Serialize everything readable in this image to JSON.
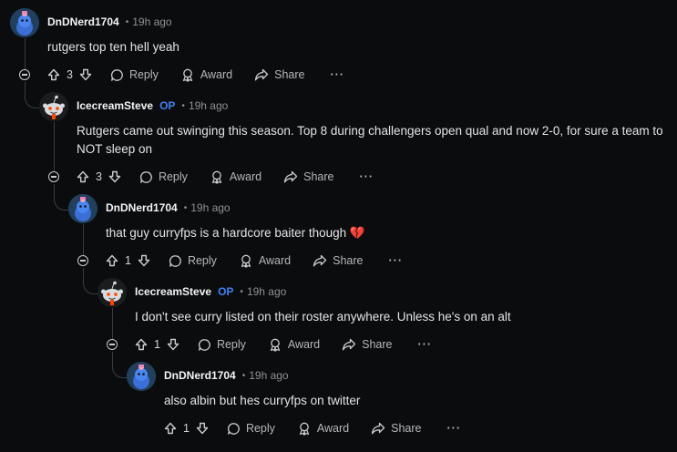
{
  "comments": [
    {
      "author": "DnDNerd1704",
      "is_op": false,
      "time": "19h ago",
      "text": "rutgers top ten hell yeah",
      "votes": "3",
      "reply_label": "Reply",
      "award_label": "Award",
      "share_label": "Share",
      "more_label": "···"
    },
    {
      "author": "IcecreamSteve",
      "is_op": true,
      "op_label": "OP",
      "time": "19h ago",
      "text": "Rutgers came out swinging this season. Top 8 during challengers open qual and now 2-0, for sure a team to NOT sleep on",
      "votes": "3",
      "reply_label": "Reply",
      "award_label": "Award",
      "share_label": "Share",
      "more_label": "···"
    },
    {
      "author": "DnDNerd1704",
      "is_op": false,
      "time": "19h ago",
      "text": "that guy curryfps is a hardcore baiter though 💔",
      "votes": "1",
      "reply_label": "Reply",
      "award_label": "Award",
      "share_label": "Share",
      "more_label": "···"
    },
    {
      "author": "IcecreamSteve",
      "is_op": true,
      "op_label": "OP",
      "time": "19h ago",
      "text": "I don't see curry listed on their roster anywhere. Unless he's on an alt",
      "votes": "1",
      "reply_label": "Reply",
      "award_label": "Award",
      "share_label": "Share",
      "more_label": "···"
    },
    {
      "author": "DnDNerd1704",
      "is_op": false,
      "time": "19h ago",
      "text": "also albin but hes curryfps on twitter",
      "votes": "1",
      "reply_label": "Reply",
      "award_label": "Award",
      "share_label": "Share",
      "more_label": "···"
    }
  ],
  "separator": "•",
  "colors": {
    "background": "#0b0c0d",
    "op_badge": "#3b82f6",
    "thread_line": "#3a3d3f"
  }
}
